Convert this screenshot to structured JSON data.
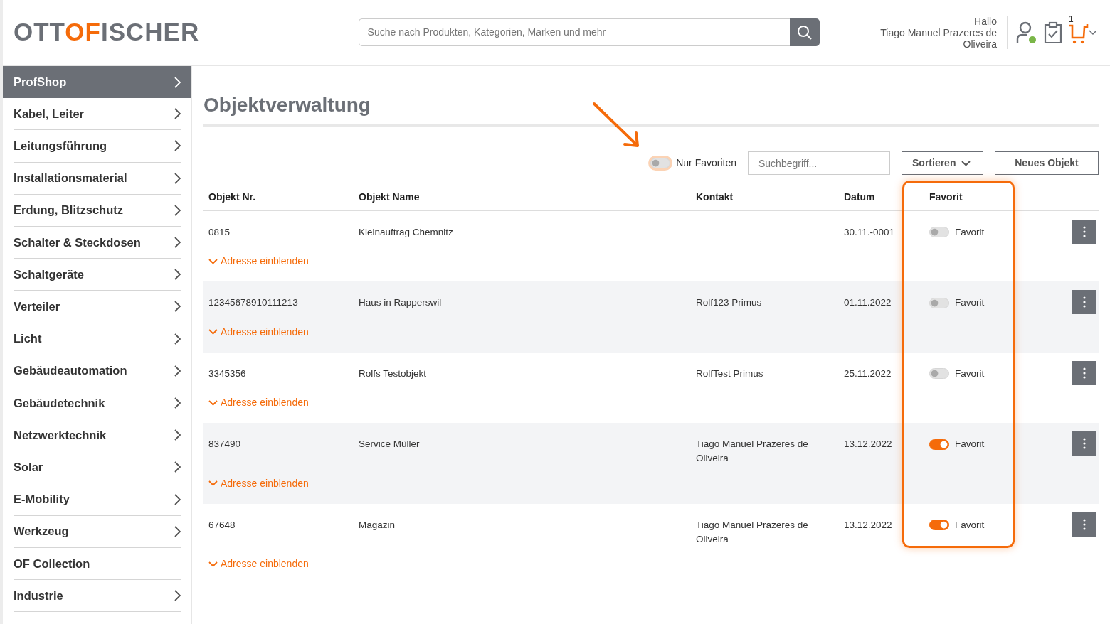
{
  "header": {
    "logo": [
      {
        "text": "OTT",
        "accent": false
      },
      {
        "text": "OF",
        "accent": true
      },
      {
        "text": "ISCHER",
        "accent": false
      }
    ],
    "search": {
      "placeholder": "Suche nach Produkten, Kategorien, Marken und mehr"
    },
    "greeting": "Hallo",
    "user_name": "Tiago Manuel Prazeres de Oliveira",
    "cart_count": "1"
  },
  "sidebar": {
    "items": [
      {
        "label": "ProfShop",
        "selected": true,
        "submenu": true
      },
      {
        "label": "Kabel, Leiter",
        "selected": false,
        "submenu": true
      },
      {
        "label": "Leitungsführung",
        "selected": false,
        "submenu": true
      },
      {
        "label": "Installationsmaterial",
        "selected": false,
        "submenu": true
      },
      {
        "label": "Erdung, Blitzschutz",
        "selected": false,
        "submenu": true
      },
      {
        "label": "Schalter & Steckdosen",
        "selected": false,
        "submenu": true
      },
      {
        "label": "Schaltgeräte",
        "selected": false,
        "submenu": true
      },
      {
        "label": "Verteiler",
        "selected": false,
        "submenu": true
      },
      {
        "label": "Licht",
        "selected": false,
        "submenu": true
      },
      {
        "label": "Gebäudeautomation",
        "selected": false,
        "submenu": true
      },
      {
        "label": "Gebäudetechnik",
        "selected": false,
        "submenu": true
      },
      {
        "label": "Netzwerktechnik",
        "selected": false,
        "submenu": true
      },
      {
        "label": "Solar",
        "selected": false,
        "submenu": true
      },
      {
        "label": "E-Mobility",
        "selected": false,
        "submenu": true
      },
      {
        "label": "Werkzeug",
        "selected": false,
        "submenu": true
      },
      {
        "label": "OF Collection",
        "selected": false,
        "submenu": false
      },
      {
        "label": "Industrie",
        "selected": false,
        "submenu": true
      }
    ]
  },
  "page_title": "Objektverwaltung",
  "toolbar": {
    "favorites_only": {
      "label": "Nur Favoriten",
      "on": false
    },
    "search": {
      "placeholder": "Suchbegriff..."
    },
    "sort_button": "Sortieren",
    "new_button": "Neues Objekt"
  },
  "table": {
    "columns": [
      "Objekt Nr.",
      "Objekt Name",
      "Kontakt",
      "Datum",
      "Favorit"
    ],
    "rows": [
      {
        "number": "0815",
        "name": "Kleinauftrag Chemnitz",
        "contact": "",
        "date": "30.11.-0001",
        "favorite": false,
        "favorite_label": "Favorit",
        "address_link": "Adresse einblenden"
      },
      {
        "number": "12345678910111213",
        "name": "Haus in Rapperswil",
        "contact": "Rolf123 Primus",
        "date": "01.11.2022",
        "favorite": false,
        "favorite_label": "Favorit",
        "address_link": "Adresse einblenden"
      },
      {
        "number": "3345356",
        "name": "Rolfs Testobjekt",
        "contact": "RolfTest Primus",
        "date": "25.11.2022",
        "favorite": false,
        "favorite_label": "Favorit",
        "address_link": "Adresse einblenden"
      },
      {
        "number": "837490",
        "name": "Service Müller",
        "contact": "Tiago Manuel Prazeres de Oliveira",
        "date": "13.12.2022",
        "favorite": true,
        "favorite_label": "Favorit",
        "address_link": "Adresse einblenden"
      },
      {
        "number": "67648",
        "name": "Magazin",
        "contact": "Tiago Manuel Prazeres de Oliveira",
        "date": "13.12.2022",
        "favorite": true,
        "favorite_label": "Favorit",
        "address_link": "Adresse einblenden"
      }
    ]
  }
}
